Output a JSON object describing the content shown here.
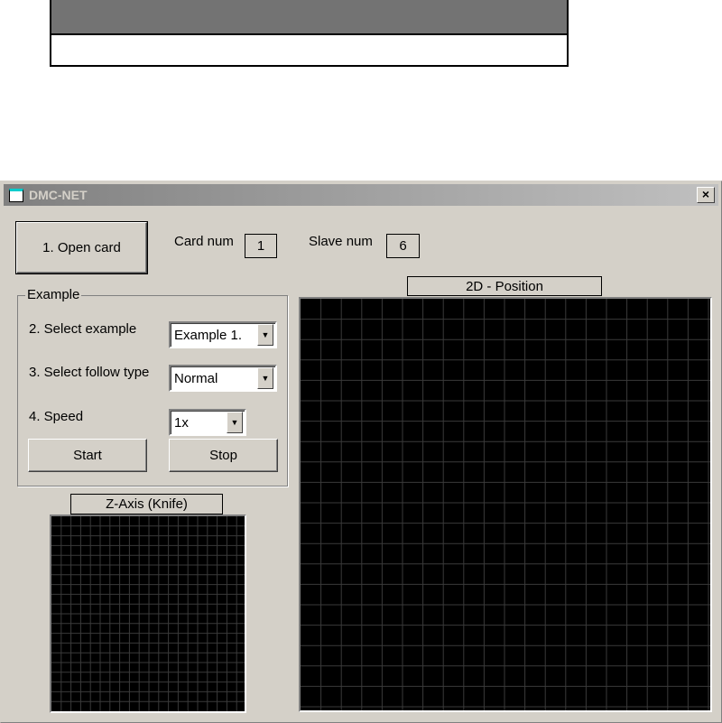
{
  "window": {
    "title": "DMC-NET",
    "close_label": "×"
  },
  "open_card_label": "1. Open card",
  "card_num": {
    "label": "Card num",
    "value": "1"
  },
  "slave_num": {
    "label": "Slave num",
    "value": "6"
  },
  "example_group": {
    "title": "Example",
    "select_example": {
      "label": "2. Select example",
      "value": "Example 1."
    },
    "follow_type": {
      "label": "3. Select follow type",
      "value": "Normal"
    },
    "speed": {
      "label": "4. Speed",
      "value": "1x"
    },
    "start_label": "Start",
    "stop_label": "Stop"
  },
  "z_axis": {
    "title": "Z-Axis (Knife)"
  },
  "position_2d": {
    "title": "2D - Position"
  },
  "colors": {
    "plot_bg": "#000000",
    "grid": "#3a3a3a",
    "face": "#d4d0c8"
  }
}
